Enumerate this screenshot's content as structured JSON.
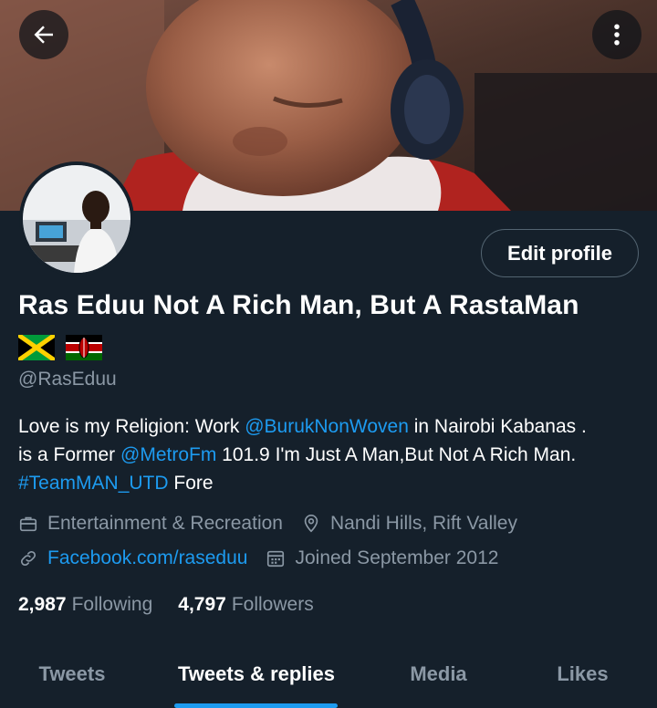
{
  "header": {
    "back_icon": "arrow-left-icon",
    "more_icon": "more-vertical-icon"
  },
  "profile": {
    "display_name": "Ras Eduu Not A Rich Man, But A RastaMan",
    "flags": [
      "jamaica-flag",
      "kenya-flag"
    ],
    "handle": "@RasEduu",
    "edit_button_label": "Edit profile"
  },
  "bio": {
    "l1_a": "Love is my Religion:  Work ",
    "l1_link": "@BurukNonWoven",
    "l1_b": " in Nairobi Kabanas .",
    "l2_a": "is a Former ",
    "l2_link": "@MetroFm",
    "l2_b": " 101.9 I'm Just A Man,But Not A Rich Man.",
    "l3_link": "#TeamMAN_UTD",
    "l3_b": " Fore"
  },
  "meta": {
    "category": "Entertainment & Recreation",
    "location": "Nandi Hills, Rift Valley",
    "website": "Facebook.com/raseduu",
    "joined": "Joined September 2012"
  },
  "stats": {
    "following_count": "2,987",
    "following_label": "Following",
    "followers_count": "4,797",
    "followers_label": "Followers"
  },
  "tabs": [
    {
      "label": "Tweets",
      "active": false
    },
    {
      "label": "Tweets & replies",
      "active": true
    },
    {
      "label": "Media",
      "active": false
    },
    {
      "label": "Likes",
      "active": false
    }
  ],
  "colors": {
    "background": "#15202b",
    "accent": "#1d9bf0",
    "secondary_text": "#8b98a5",
    "border": "#536471"
  }
}
